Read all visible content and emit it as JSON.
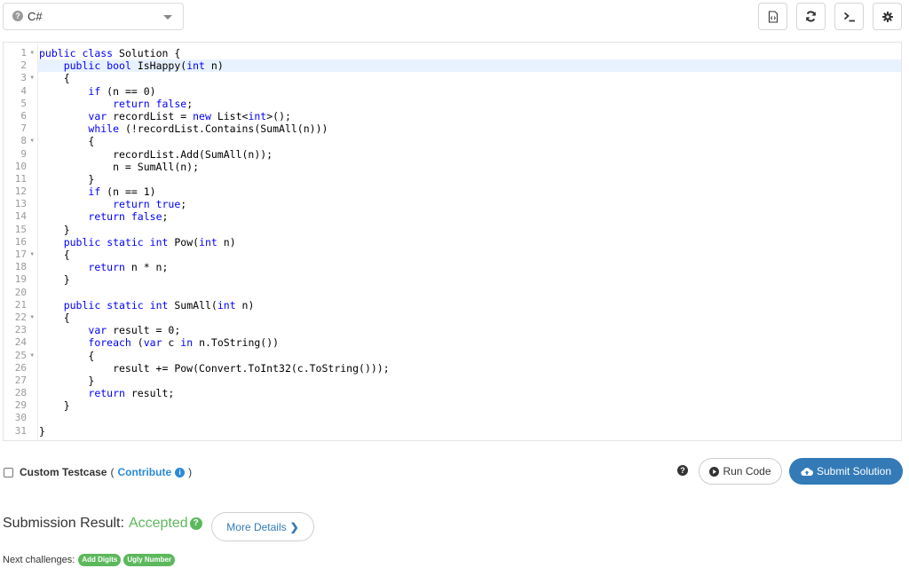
{
  "toolbar": {
    "language": "C#",
    "language_help_icon": "question-circle-icon",
    "buttons": [
      {
        "name": "format-code-button",
        "icon": "file-code-icon"
      },
      {
        "name": "reset-code-button",
        "icon": "refresh-icon"
      },
      {
        "name": "console-button",
        "icon": "terminal-icon"
      },
      {
        "name": "settings-button",
        "icon": "gear-icon"
      }
    ]
  },
  "editor": {
    "active_line": 2,
    "fold_lines": [
      1,
      3,
      8,
      17,
      22,
      25
    ],
    "lines": [
      "public class Solution {",
      "    public bool IsHappy(int n)",
      "    {",
      "        if (n == 0)",
      "            return false;",
      "        var recordList = new List<int>();",
      "        while (!recordList.Contains(SumAll(n)))",
      "        {",
      "            recordList.Add(SumAll(n));",
      "            n = SumAll(n);",
      "        }",
      "        if (n == 1)",
      "            return true;",
      "        return false;",
      "    }",
      "    public static int Pow(int n)",
      "    {",
      "        return n * n;",
      "    }",
      "",
      "    public static int SumAll(int n)",
      "    {",
      "        var result = 0;",
      "        foreach (var c in n.ToString())",
      "        {",
      "            result += Pow(Convert.ToInt32(c.ToString()));",
      "        }",
      "        return result;",
      "    }",
      "",
      "}"
    ]
  },
  "actions": {
    "custom_testcase_label": "Custom Testcase",
    "paren_open": "(",
    "contribute_label": "Contribute",
    "paren_close": ")",
    "run_label": "Run Code",
    "submit_label": "Submit Solution"
  },
  "result": {
    "label": "Submission Result:",
    "status": "Accepted",
    "more_details_label": "More Details",
    "next_label": "Next challenges:",
    "next_challenges": [
      "Add Digits",
      "Ugly Number"
    ]
  },
  "colors": {
    "accent": "#337ab7",
    "accepted": "#5cb85c",
    "link": "#2a8ad6"
  }
}
